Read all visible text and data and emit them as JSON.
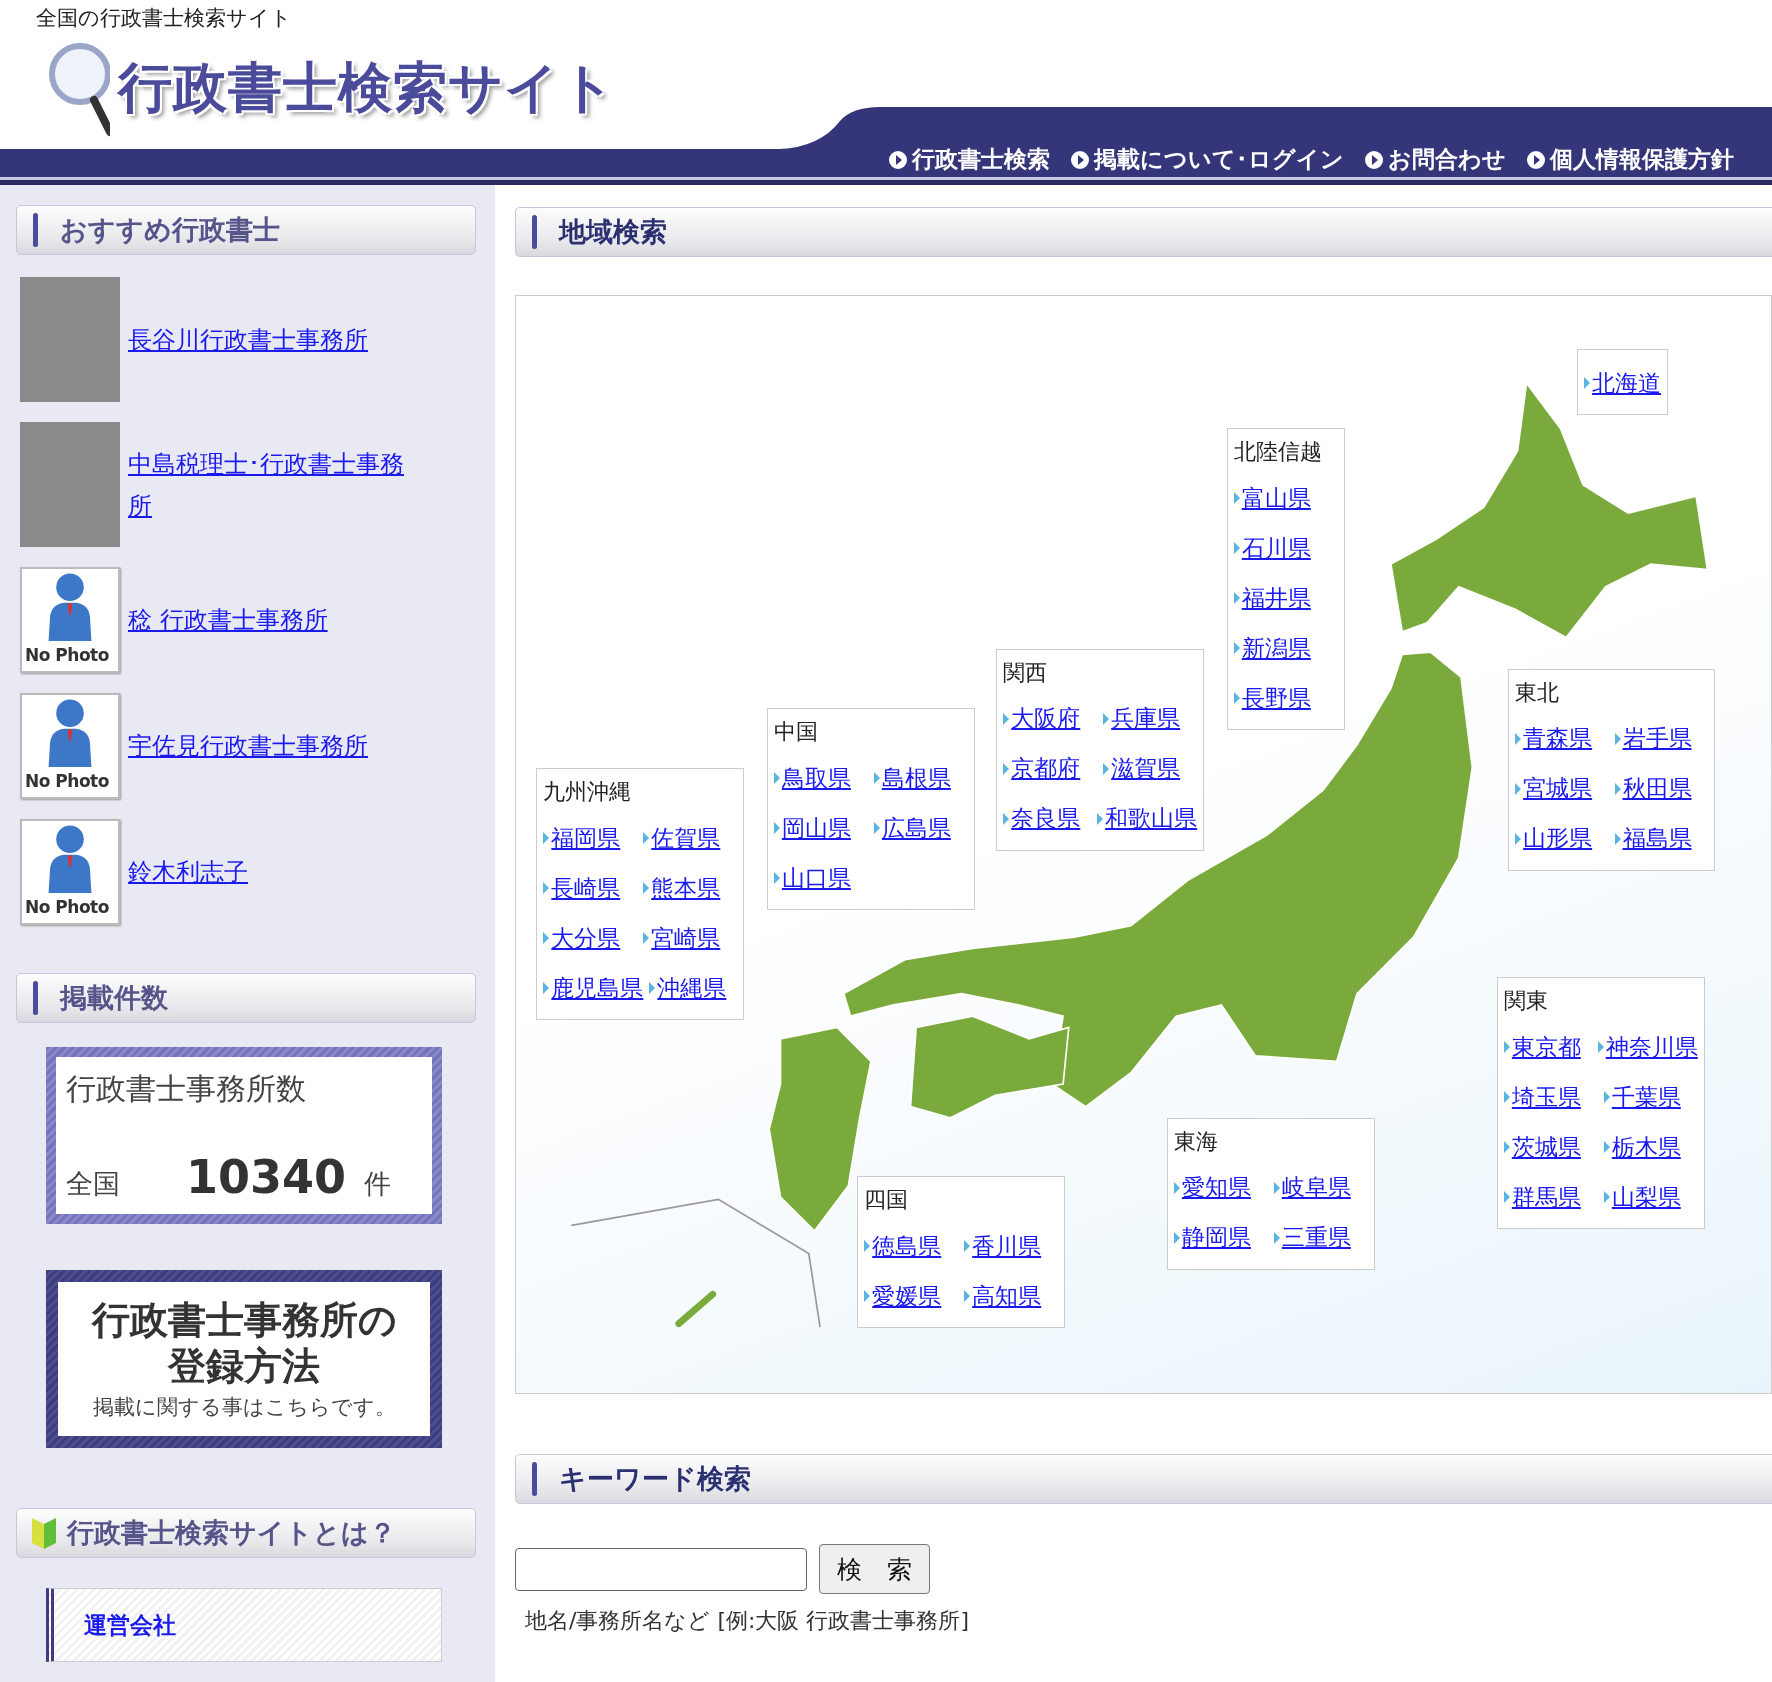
{
  "header": {
    "tagline": "全国の行政書士検索サイト",
    "logo_text": "行政書士検索サイト",
    "nav": [
      "行政書士検索",
      "掲載について･ログイン",
      "お問合わせ",
      "個人情報保護方針"
    ]
  },
  "sidebar": {
    "recommended": {
      "title": "おすすめ行政書士",
      "items": [
        {
          "kind": "photo",
          "name": "長谷川行政書士事務所"
        },
        {
          "kind": "photo",
          "name": "中島税理士･行政書士事務所"
        },
        {
          "kind": "no_photo",
          "photo_label": "No Photo",
          "name": "稔 行政書士事務所"
        },
        {
          "kind": "no_photo",
          "photo_label": "No Photo",
          "name": "宇佐見行政書士事務所"
        },
        {
          "kind": "no_photo",
          "photo_label": "No Photo",
          "name": "鈴木利志子"
        }
      ]
    },
    "listing_count": {
      "title": "掲載件数",
      "label": "行政書士事務所数",
      "area": "全国",
      "count": "10340",
      "unit": "件"
    },
    "registration_banner": {
      "title_lines": [
        "行政書士事務所の",
        "登録方法"
      ],
      "subtitle": "掲載に関する事はこちらです。"
    },
    "about": {
      "title": "行政書士検索サイトとは？",
      "links": [
        "運営会社"
      ]
    }
  },
  "area_search": {
    "title": "地域検索",
    "regions": [
      {
        "rows": [
          [
            "北海道"
          ]
        ]
      },
      {
        "title": "北陸信越",
        "rows": [
          [
            "富山県"
          ],
          [
            "石川県"
          ],
          [
            "福井県"
          ],
          [
            "新潟県"
          ],
          [
            "長野県"
          ]
        ]
      },
      {
        "title": "関西",
        "rows": [
          [
            "大阪府",
            "兵庫県"
          ],
          [
            "京都府",
            "滋賀県"
          ],
          [
            "奈良県",
            "和歌山県"
          ]
        ]
      },
      {
        "title": "中国",
        "rows": [
          [
            "鳥取県",
            "島根県"
          ],
          [
            "岡山県",
            "広島県"
          ],
          [
            "山口県"
          ]
        ]
      },
      {
        "title": "九州沖縄",
        "rows": [
          [
            "福岡県",
            "佐賀県"
          ],
          [
            "長崎県",
            "熊本県"
          ],
          [
            "大分県",
            "宮崎県"
          ],
          [
            "鹿児島県",
            "沖縄県"
          ]
        ]
      },
      {
        "title": "東北",
        "rows": [
          [
            "青森県",
            "岩手県"
          ],
          [
            "宮城県",
            "秋田県"
          ],
          [
            "山形県",
            "福島県"
          ]
        ]
      },
      {
        "title": "関東",
        "rows": [
          [
            "東京都",
            "神奈川県"
          ],
          [
            "埼玉県",
            "千葉県"
          ],
          [
            "茨城県",
            "栃木県"
          ],
          [
            "群馬県",
            "山梨県"
          ]
        ]
      },
      {
        "title": "東海",
        "rows": [
          [
            "愛知県",
            "岐阜県"
          ],
          [
            "静岡県",
            "三重県"
          ]
        ]
      },
      {
        "title": "四国",
        "rows": [
          [
            "徳島県",
            "香川県"
          ],
          [
            "愛媛県",
            "高知県"
          ]
        ]
      }
    ]
  },
  "keyword_search": {
    "title": "キーワード検索",
    "button": "検　索",
    "hint": "地名/事務所名など [例:大阪 行政書士事務所]"
  }
}
